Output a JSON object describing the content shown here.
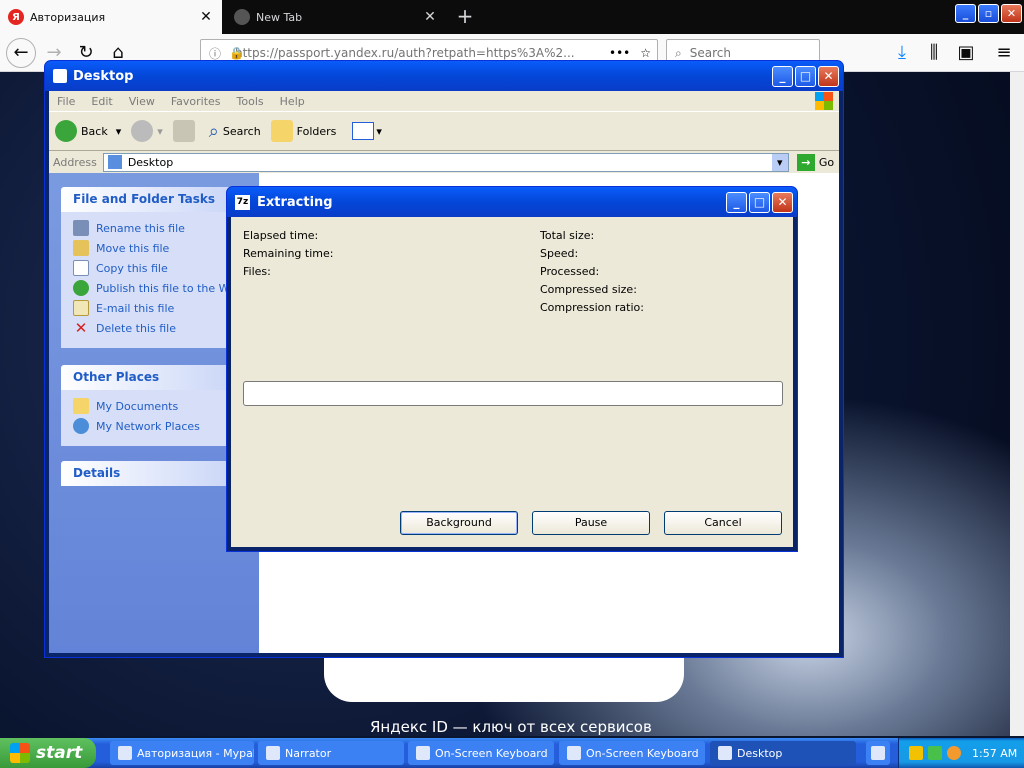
{
  "browser": {
    "tabs": [
      {
        "label": "Авторизация",
        "favicon": "yandex-icon",
        "active": true
      },
      {
        "label": "New Tab",
        "favicon": "firefox-icon",
        "active": false
      }
    ],
    "url": "https://passport.yandex.ru/auth?retpath=https%3A%2...",
    "search_placeholder": "Search"
  },
  "page": {
    "footer_text": "Яндекс ID — ключ от всех сервисов"
  },
  "explorer": {
    "title": "Desktop",
    "menu": [
      "File",
      "Edit",
      "View",
      "Favorites",
      "Tools",
      "Help"
    ],
    "toolbar": {
      "back": "Back",
      "search": "Search",
      "folders": "Folders"
    },
    "address_label": "Address",
    "address_value": "Desktop",
    "go_label": "Go",
    "file_tasks": {
      "title": "File and Folder Tasks",
      "items": [
        "Rename this file",
        "Move this file",
        "Copy this file",
        "Publish this file to the Web",
        "E-mail this file",
        "Delete this file"
      ]
    },
    "other_places": {
      "title": "Other Places",
      "items": [
        "My Documents",
        "My Network Places"
      ]
    },
    "details": {
      "title": "Details"
    }
  },
  "dialog": {
    "title": "Extracting",
    "left_stats": [
      "Elapsed time:",
      "Remaining time:",
      "Files:"
    ],
    "right_stats": [
      "Total size:",
      "Speed:",
      "Processed:",
      "Compressed size:",
      "Compression ratio:"
    ],
    "progress": 0,
    "buttons": {
      "background": "Background",
      "pause": "Pause",
      "cancel": "Cancel"
    }
  },
  "taskbar": {
    "start": "start",
    "items": [
      "Авторизация - Mypal",
      "Narrator",
      "On-Screen Keyboard",
      "On-Screen Keyboard",
      "Desktop"
    ],
    "clock": "1:57 AM"
  }
}
